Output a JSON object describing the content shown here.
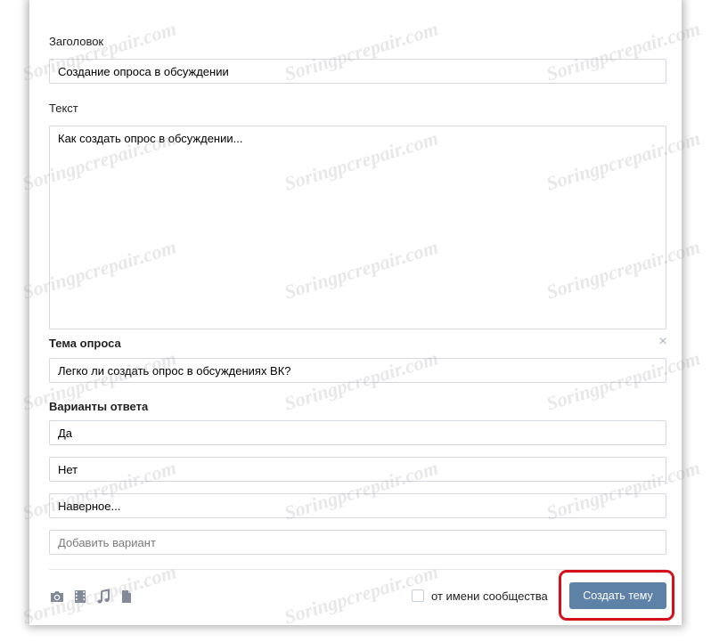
{
  "form": {
    "title_label": "Заголовок",
    "title_value": "Создание опроса в обсуждении",
    "text_label": "Текст",
    "text_value": "Как создать опрос в обсуждении...",
    "poll": {
      "topic_label": "Тема опроса",
      "topic_value": "Легко ли создать опрос в обсуждениях ВК?",
      "options_label": "Варианты ответа",
      "options": [
        "Да",
        "Нет",
        "Наверное..."
      ],
      "add_option_placeholder": "Добавить вариант",
      "remove_icon": "×"
    }
  },
  "footer": {
    "attach_icons": [
      "camera-icon",
      "video-icon",
      "music-icon",
      "document-icon"
    ],
    "community_checkbox_label": "от имени сообщества",
    "community_checked": false,
    "submit_label": "Создать тему"
  },
  "watermark": "Soringpcrepair.com",
  "colors": {
    "accent": "#5e81a8",
    "highlight": "#d5101b",
    "border": "#d3d9de"
  }
}
